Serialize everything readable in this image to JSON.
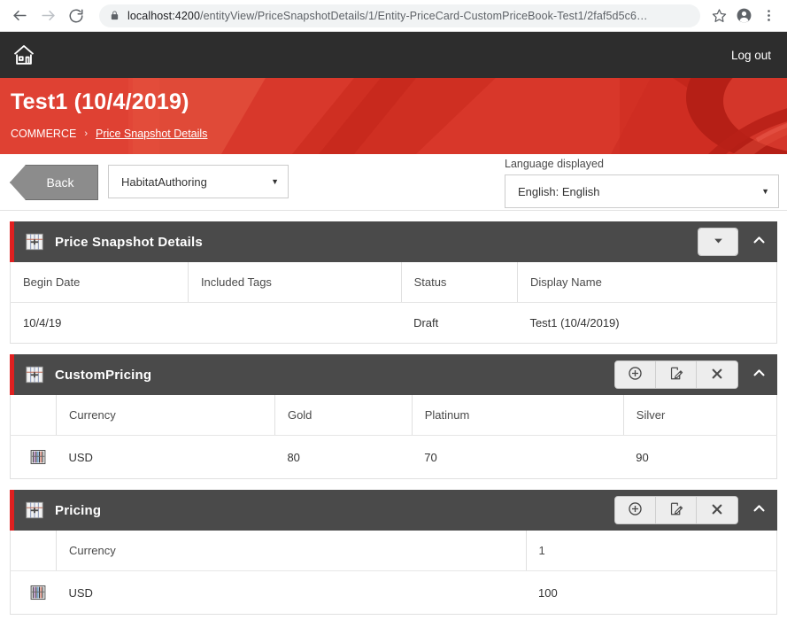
{
  "browser": {
    "back_icon": "back-arrow-icon",
    "forward_icon": "forward-arrow-icon",
    "reload_icon": "reload-icon",
    "lock_icon": "lock-icon",
    "url_host": "localhost:4200",
    "url_path": "/entityView/PriceSnapshotDetails/1/Entity-PriceCard-CustomPriceBook-Test1/2faf5d5c6…",
    "star_icon": "bookmark-star-icon",
    "profile_icon": "account-avatar-icon",
    "menu_icon": "three-dot-menu-icon"
  },
  "app_nav": {
    "home_icon": "home-icon",
    "logout_label": "Log out"
  },
  "hero": {
    "title": "Test1 (10/4/2019)",
    "breadcrumb_root": "COMMERCE",
    "breadcrumb_separator": "›",
    "breadcrumb_current": "Price Snapshot Details",
    "accent_color": "#d32b20"
  },
  "toolbar": {
    "back_label": "Back",
    "context_value": "HabitatAuthoring",
    "caret_icon": "chevron-down-icon",
    "language_label": "Language displayed",
    "language_value": "English: English"
  },
  "panels": [
    {
      "id": "price-snapshot-details",
      "icon": "table-grid-icon",
      "title": "Price Snapshot Details",
      "actions": [
        {
          "name": "more-actions-button",
          "icon": "caret-down-icon"
        }
      ],
      "collapse_icon": "chevron-up-icon",
      "columns": [
        "Begin Date",
        "Included Tags",
        "Status",
        "Display Name"
      ],
      "has_row_icon": false,
      "rows": [
        [
          "10/4/19",
          "",
          "Draft",
          "Test1 (10/4/2019)"
        ]
      ]
    },
    {
      "id": "custom-pricing",
      "icon": "table-grid-icon",
      "title": "CustomPricing",
      "actions": [
        {
          "name": "add-button",
          "icon": "plus-circle-icon"
        },
        {
          "name": "edit-button",
          "icon": "edit-pencil-icon"
        },
        {
          "name": "delete-button",
          "icon": "close-x-icon"
        }
      ],
      "collapse_icon": "chevron-up-icon",
      "columns": [
        "Currency",
        "Gold",
        "Platinum",
        "Silver"
      ],
      "has_row_icon": true,
      "row_icon": "barcode-icon",
      "rows": [
        [
          "USD",
          "80",
          "70",
          "90"
        ]
      ]
    },
    {
      "id": "pricing",
      "icon": "table-grid-icon",
      "title": "Pricing",
      "actions": [
        {
          "name": "add-button",
          "icon": "plus-circle-icon"
        },
        {
          "name": "edit-button",
          "icon": "edit-pencil-icon"
        },
        {
          "name": "delete-button",
          "icon": "close-x-icon"
        }
      ],
      "collapse_icon": "chevron-up-icon",
      "columns": [
        "Currency",
        "1"
      ],
      "has_row_icon": true,
      "row_icon": "barcode-icon",
      "rows": [
        [
          "USD",
          "100"
        ]
      ]
    }
  ]
}
